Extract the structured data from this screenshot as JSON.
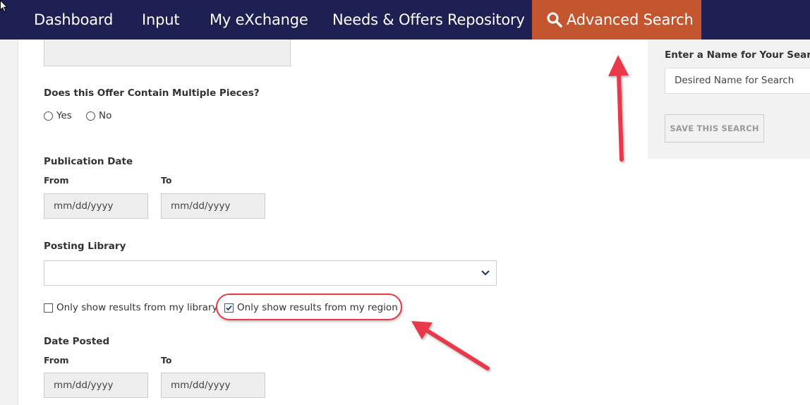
{
  "nav": {
    "items": [
      {
        "label": "Dashboard"
      },
      {
        "label": "Input"
      },
      {
        "label": "My eXchange"
      },
      {
        "label": "Needs & Offers Repository"
      }
    ],
    "active": {
      "label": "Advanced Search",
      "icon": "search-icon"
    },
    "bg_color": "#1e1f52",
    "active_color": "#c4562f"
  },
  "form": {
    "multiple_pieces": {
      "label": "Does this Offer Contain Multiple Pieces?",
      "options": [
        "Yes",
        "No"
      ]
    },
    "publication_date": {
      "label": "Publication Date",
      "from_label": "From",
      "to_label": "To",
      "from_placeholder": "mm/dd/yyyy",
      "to_placeholder": "mm/dd/yyyy"
    },
    "posting_library": {
      "label": "Posting Library",
      "selected": ""
    },
    "checkboxes": {
      "my_library": {
        "label": "Only show results from my library",
        "checked": false
      },
      "my_region": {
        "label": "Only show results from my region",
        "checked": true
      }
    },
    "date_posted": {
      "label": "Date Posted",
      "from_label": "From",
      "to_label": "To",
      "from_placeholder": "mm/dd/yyyy",
      "to_placeholder": "mm/dd/yyyy"
    }
  },
  "save_panel": {
    "label": "Enter a Name for Your Search",
    "input_value": "Desired Name for Search",
    "button_label": "SAVE THIS SEARCH"
  },
  "annotation_color": "#e8384a"
}
